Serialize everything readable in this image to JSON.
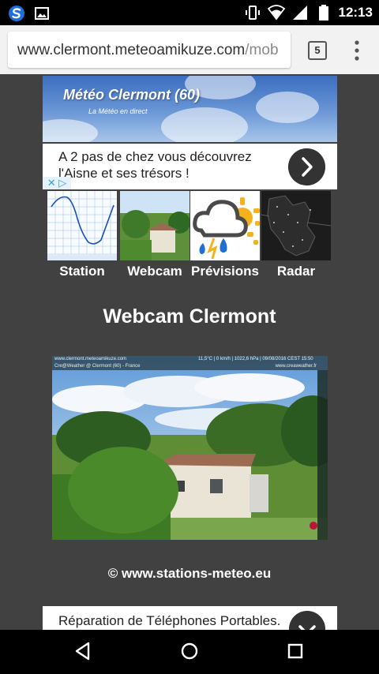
{
  "status_bar": {
    "time": "12:13",
    "left_icons": [
      "app-logo-icon",
      "image-notification-icon"
    ],
    "right_icons": [
      "vibrate-icon",
      "wifi-icon",
      "signal-icon",
      "battery-icon"
    ]
  },
  "browser": {
    "url_main": "www.clermont.meteoamikuze.com",
    "url_rest": "/mob",
    "tab_count": "5"
  },
  "header": {
    "title": "Météo Clermont (60)",
    "subtitle": "La Météo en direct"
  },
  "ad_top": {
    "text": "A 2 pas de chez vous découvrez l'Aisne et ses trésors !"
  },
  "nav": [
    {
      "label": "Station"
    },
    {
      "label": "Webcam"
    },
    {
      "label": "Prévisions"
    },
    {
      "label": "Radar"
    }
  ],
  "page_title": "Webcam Clermont",
  "webcam": {
    "overlay_left_1": "www.clermont.meteoamikuze.com",
    "overlay_left_2": "Cre@Weather @ Clermont (60) - France",
    "overlay_right_1": "11,5°C | 0 km/h | 1022,6 hPa | 09/08/2016 CEST 15:50",
    "overlay_right_2": "www.creaweather.fr"
  },
  "credit": "© www.stations-meteo.eu",
  "ad_bottom": {
    "text": "Réparation de Téléphones Portables."
  }
}
